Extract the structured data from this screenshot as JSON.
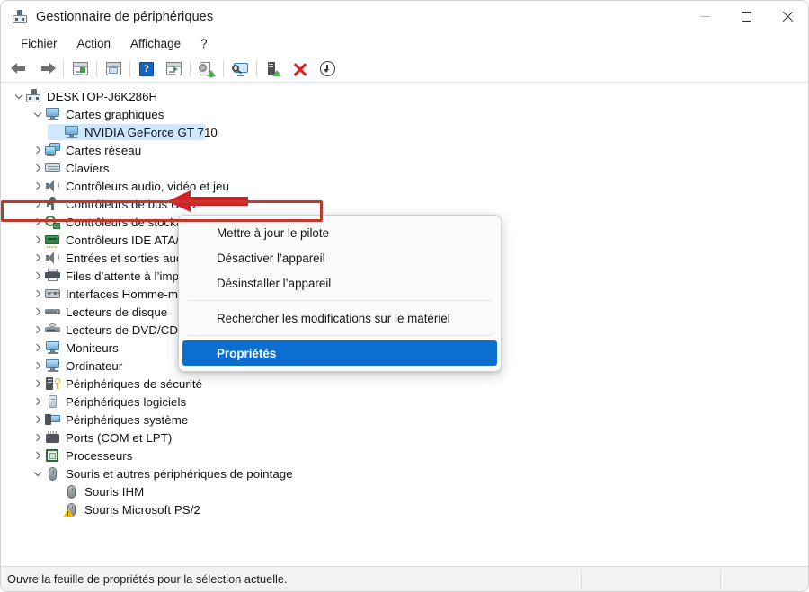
{
  "window": {
    "title": "Gestionnaire de périphériques",
    "app_icon": "device-manager-icon",
    "controls": {
      "minimize": "minimize-icon",
      "maximize": "maximize-icon",
      "close": "close-icon"
    }
  },
  "menubar": {
    "items": [
      {
        "label": "Fichier"
      },
      {
        "label": "Action"
      },
      {
        "label": "Affichage"
      },
      {
        "label": "?"
      }
    ]
  },
  "toolbar": {
    "buttons": [
      {
        "name": "back-button",
        "icon": "arrow-left-icon"
      },
      {
        "name": "forward-button",
        "icon": "arrow-right-icon"
      },
      {
        "name": "show-hidden-devices-button",
        "icon": "window-list-icon"
      },
      {
        "name": "properties-button",
        "icon": "window-properties-icon"
      },
      {
        "name": "help-button",
        "icon": "help-icon"
      },
      {
        "name": "view-devices-button",
        "icon": "window-play-icon"
      },
      {
        "name": "update-driver-button",
        "icon": "update-driver-icon"
      },
      {
        "name": "scan-hardware-button",
        "icon": "scan-monitor-icon"
      },
      {
        "name": "device-button",
        "icon": "device-add-icon"
      },
      {
        "name": "uninstall-button",
        "icon": "red-x-icon"
      },
      {
        "name": "add-legacy-hardware-button",
        "icon": "circle-down-arrow-icon"
      }
    ]
  },
  "tree": {
    "nodes": [
      {
        "label": "DESKTOP-J6K286H",
        "depth": 0,
        "twisty": "expanded",
        "icon": "computer-icon",
        "selected": false
      },
      {
        "label": "Cartes graphiques",
        "depth": 1,
        "twisty": "expanded",
        "icon": "monitor-icon",
        "selected": false
      },
      {
        "label": "NVIDIA GeForce GT 710",
        "depth": 2,
        "twisty": "none",
        "icon": "monitor-icon",
        "selected": true
      },
      {
        "label": "Cartes réseau",
        "depth": 1,
        "twisty": "collapsed",
        "icon": "network-card-icon",
        "selected": false
      },
      {
        "label": "Claviers",
        "depth": 1,
        "twisty": "collapsed",
        "icon": "keyboard-icon",
        "selected": false
      },
      {
        "label": "Contrôleurs audio, vidéo et jeu",
        "depth": 1,
        "twisty": "collapsed",
        "icon": "speaker-icon",
        "selected": false
      },
      {
        "label": "Contrôleurs de bus USB",
        "depth": 1,
        "twisty": "collapsed",
        "icon": "usb-icon",
        "selected": false
      },
      {
        "label": "Contrôleurs de stockage",
        "depth": 1,
        "twisty": "collapsed",
        "icon": "storage-controller-icon",
        "selected": false
      },
      {
        "label": "Contrôleurs IDE ATA/ATAPI",
        "depth": 1,
        "twisty": "collapsed",
        "icon": "ide-card-icon",
        "selected": false
      },
      {
        "label": "Entrées et sorties audio",
        "depth": 1,
        "twisty": "collapsed",
        "icon": "speaker-icon",
        "selected": false
      },
      {
        "label": "Files d’attente à l’impression :",
        "depth": 1,
        "twisty": "collapsed",
        "icon": "printer-icon",
        "selected": false
      },
      {
        "label": "Interfaces Homme-machine",
        "depth": 1,
        "twisty": "collapsed",
        "icon": "hid-icon",
        "selected": false
      },
      {
        "label": "Lecteurs de disque",
        "depth": 1,
        "twisty": "collapsed",
        "icon": "disk-drive-icon",
        "selected": false
      },
      {
        "label": "Lecteurs de DVD/CD-ROM",
        "depth": 1,
        "twisty": "collapsed",
        "icon": "dvd-drive-icon",
        "selected": false
      },
      {
        "label": "Moniteurs",
        "depth": 1,
        "twisty": "collapsed",
        "icon": "monitor-icon",
        "selected": false
      },
      {
        "label": "Ordinateur",
        "depth": 1,
        "twisty": "collapsed",
        "icon": "monitor-icon",
        "selected": false
      },
      {
        "label": "Périphériques de sécurité",
        "depth": 1,
        "twisty": "collapsed",
        "icon": "security-device-icon",
        "selected": false
      },
      {
        "label": "Périphériques logiciels",
        "depth": 1,
        "twisty": "collapsed",
        "icon": "software-device-icon",
        "selected": false
      },
      {
        "label": "Périphériques système",
        "depth": 1,
        "twisty": "collapsed",
        "icon": "system-device-icon",
        "selected": false
      },
      {
        "label": "Ports (COM et LPT)",
        "depth": 1,
        "twisty": "collapsed",
        "icon": "port-icon",
        "selected": false
      },
      {
        "label": "Processeurs",
        "depth": 1,
        "twisty": "collapsed",
        "icon": "cpu-icon",
        "selected": false
      },
      {
        "label": "Souris et autres périphériques de pointage",
        "depth": 1,
        "twisty": "expanded",
        "icon": "mouse-icon",
        "selected": false
      },
      {
        "label": "Souris IHM",
        "depth": 2,
        "twisty": "none",
        "icon": "mouse-icon",
        "selected": false
      },
      {
        "label": "Souris Microsoft PS/2",
        "depth": 2,
        "twisty": "none",
        "icon": "mouse-warning-icon",
        "selected": false
      }
    ]
  },
  "context_menu": {
    "items": [
      {
        "label": "Mettre à jour le pilote",
        "type": "item",
        "highlighted": false
      },
      {
        "label": "Désactiver l’appareil",
        "type": "item",
        "highlighted": false
      },
      {
        "label": "Désinstaller l’appareil",
        "type": "item",
        "highlighted": false
      },
      {
        "label": "",
        "type": "separator",
        "highlighted": false
      },
      {
        "label": "Rechercher les modifications sur le matériel",
        "type": "item",
        "highlighted": false
      },
      {
        "label": "",
        "type": "separator",
        "highlighted": false
      },
      {
        "label": "Propriétés",
        "type": "item",
        "highlighted": true
      }
    ]
  },
  "annotations": {
    "arrow_color": "#d42027",
    "highlight_ring_color": "#c0392b",
    "arrow_target": "Cartes graphiques"
  },
  "statusbar": {
    "text": "Ouvre la feuille de propriétés pour la sélection actuelle."
  },
  "colors": {
    "selection_blue": "#cde8ff",
    "menu_highlight_blue": "#0a6fd0",
    "annotation_red": "#d42027"
  }
}
